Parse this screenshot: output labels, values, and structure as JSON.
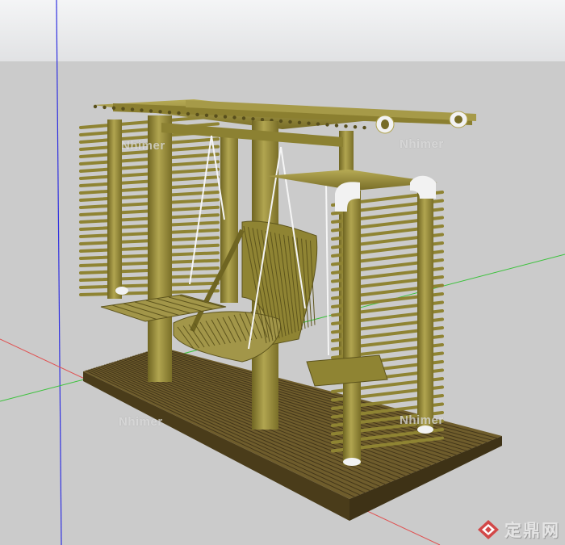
{
  "scene": {
    "subject": "bamboo swing pavilion 3D model",
    "colors": {
      "sky_top": "#f4f5f6",
      "sky_bottom": "#e1e2e4",
      "ground": "#cbcbcb",
      "bamboo": "#9c8f3a",
      "bamboo_dark": "#6f6522",
      "bamboo_light": "#bcb15c",
      "deck": "#6f5d2c",
      "deck_dark": "#3e3216",
      "cap_white": "#f2f2f2",
      "axis_red": "#e05050",
      "axis_green": "#3cc23c",
      "axis_blue": "#3030e0",
      "rope": "#f5f5f5"
    }
  },
  "watermarks": [
    "Nhimer",
    "Nhimer",
    "Nhimer",
    "Nhimer"
  ],
  "logo": {
    "text": "定鼎网",
    "icon": "diamond-logo-icon"
  }
}
